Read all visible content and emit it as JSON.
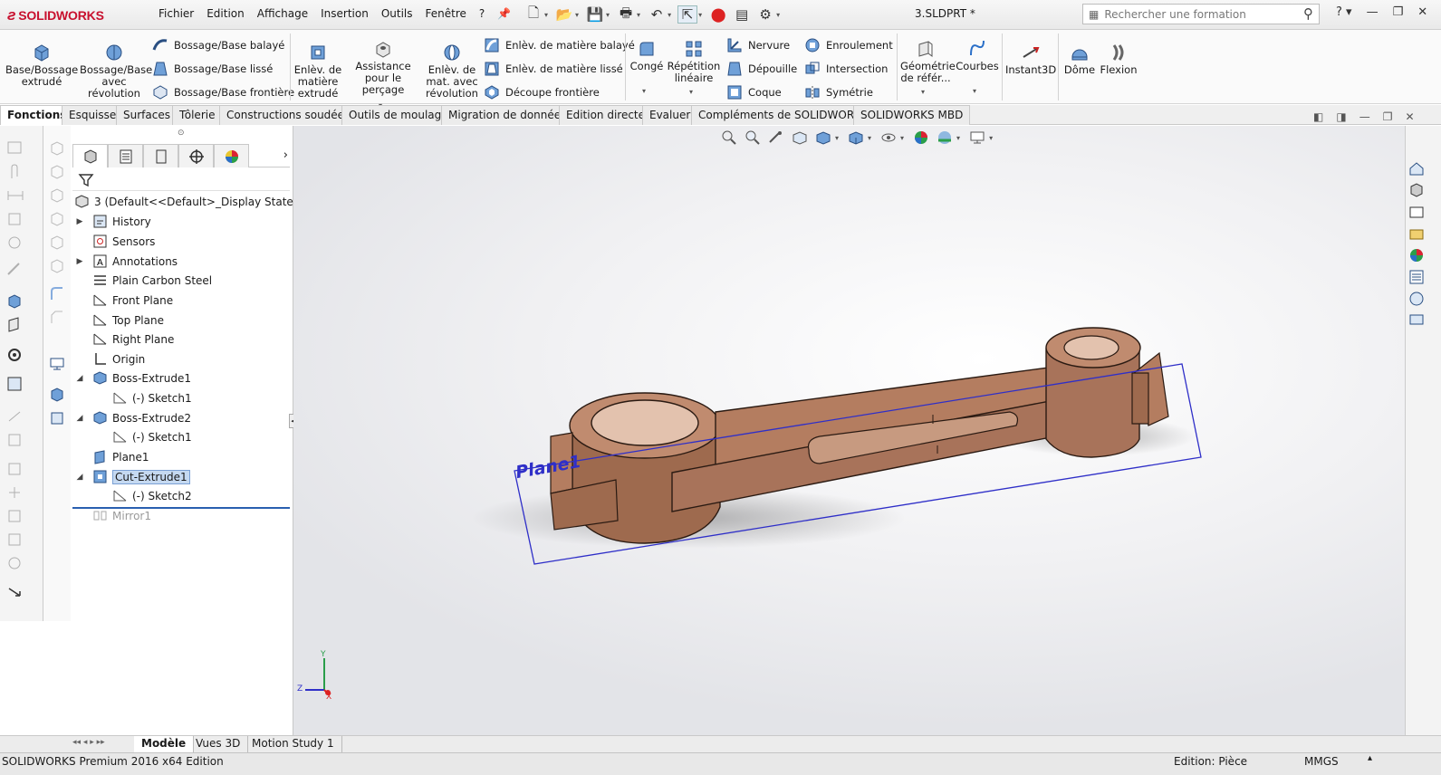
{
  "app": {
    "logo": "SOLIDWORKS",
    "document_title": "3.SLDPRT *"
  },
  "menu": [
    "Fichier",
    "Edition",
    "Affichage",
    "Insertion",
    "Outils",
    "Fenêtre",
    "?"
  ],
  "search": {
    "placeholder": "Rechercher une formation"
  },
  "ribbon": {
    "boss_extrude": "Base/Bossage extrudé",
    "boss_revolve": "Bossage/Base avec révolution",
    "swept_boss": "Bossage/Base balayé",
    "lofted_boss": "Bossage/Base lissé",
    "boundary_boss": "Bossage/Base frontière",
    "extruded_cut": "Enlèv. de matière extrudé",
    "hole_wizard": "Assistance pour le perçage",
    "revolved_cut": "Enlèv. de mat. avec révolution",
    "swept_cut": "Enlèv. de matière balayé",
    "lofted_cut": "Enlèv. de matière lissé",
    "boundary_cut": "Découpe frontière",
    "fillet": "Congé",
    "linear_pattern": "Répétition linéaire",
    "rib": "Nervure",
    "draft": "Dépouille",
    "shell": "Coque",
    "wrap": "Enroulement",
    "intersect": "Intersection",
    "mirror": "Symétrie",
    "ref_geometry": "Géométrie de référ...",
    "curves": "Courbes",
    "instant3d": "Instant3D",
    "dome": "Dôme",
    "flex": "Flexion"
  },
  "tabs": [
    "Fonctions",
    "Esquisse",
    "Surfaces",
    "Tôlerie",
    "Constructions soudées",
    "Outils de moulage",
    "Migration de données",
    "Edition directe",
    "Evaluer",
    "Compléments de SOLIDWORKS",
    "SOLIDWORKS MBD"
  ],
  "tree": {
    "root": "3  (Default<<Default>_Display State 1>)",
    "items": [
      "History",
      "Sensors",
      "Annotations",
      "Plain Carbon Steel",
      "Front Plane",
      "Top Plane",
      "Right Plane",
      "Origin",
      "Boss-Extrude1",
      "(-) Sketch1",
      "Boss-Extrude2",
      "(-) Sketch1",
      "Plane1",
      "Cut-Extrude1",
      "(-) Sketch2",
      "Mirror1"
    ]
  },
  "viewport": {
    "plane_label": "Plane1",
    "triad_x": "X",
    "triad_y": "Y",
    "triad_z": "Z"
  },
  "bottom_tabs": [
    "Modèle",
    "Vues 3D",
    "Motion Study 1"
  ],
  "status": {
    "left": "SOLIDWORKS Premium 2016 x64 Edition",
    "mode": "Edition: Pièce",
    "units": "MMGS"
  },
  "colors": {
    "brand": "#c8102e",
    "part": "#b07a5e",
    "plane": "#2f2fc8",
    "selection": "#c5d9f1"
  }
}
